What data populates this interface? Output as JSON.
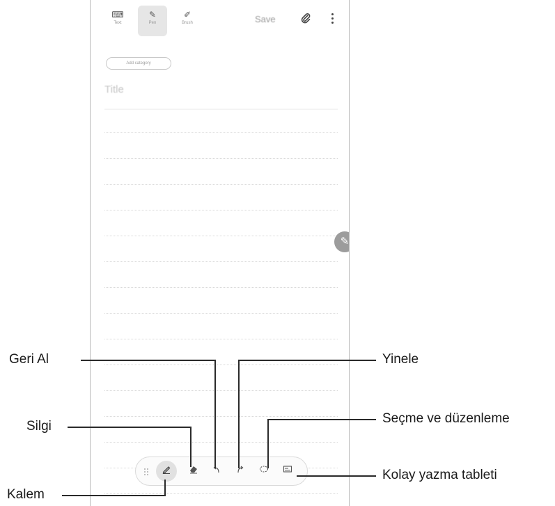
{
  "toolbar_top": {
    "modes": [
      {
        "label": "Text",
        "icon": "keyboard-icon"
      },
      {
        "label": "Pen",
        "icon": "pen-mode-icon",
        "active": true
      },
      {
        "label": "Brush",
        "icon": "brush-icon"
      }
    ],
    "save_label": "Save",
    "attach_icon": "paperclip-icon",
    "more_icon": "more-vertical-icon"
  },
  "note": {
    "category_chip": "Add category",
    "title_placeholder": "Title"
  },
  "pen_toolbar": {
    "tools": [
      "pen-icon",
      "eraser-icon",
      "undo-icon",
      "redo-icon",
      "lasso-select-icon",
      "easy-writing-pad-icon"
    ],
    "active_tool": "pen-icon"
  },
  "callouts": {
    "undo": "Geri Al",
    "eraser": "Silgi",
    "pen": "Kalem",
    "redo": "Yinele",
    "select_edit": "Seçme ve düzenleme",
    "easy_pad": "Kolay yazma tableti"
  },
  "colors": {
    "frame": "#b9b9b9",
    "leader": "#2a2a2a",
    "fab": "#9c9c9c"
  }
}
